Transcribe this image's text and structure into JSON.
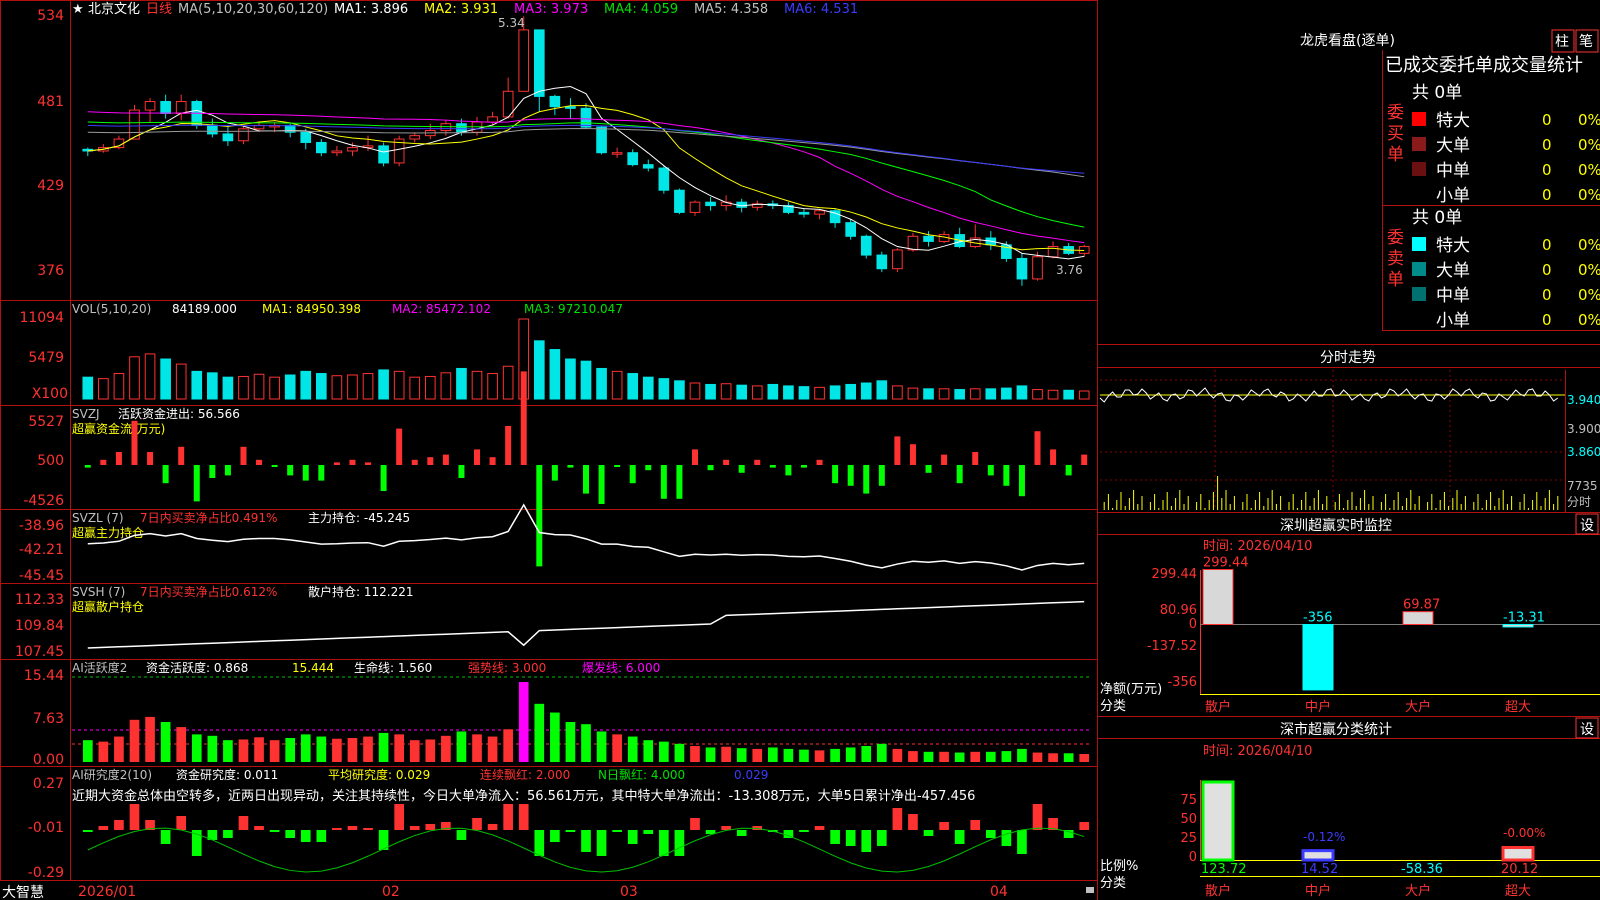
{
  "colors": {
    "up": "#ff3232",
    "down": "#00e5e5",
    "green": "#00ff00",
    "axis": "#ff3232",
    "white": "#ffffff",
    "yellow": "#ffff00",
    "magenta": "#ff00ff",
    "darkblue": "#3c3cff",
    "gray": "#9a9a9a",
    "lime": "#00e000"
  },
  "header": {
    "star": "★",
    "stock_name": "北京文化",
    "period": "日线",
    "ma_text": "MA(5,10,20,30,60,120)",
    "ma1": "MA1: 3.896",
    "ma2": "MA2: 3.931",
    "ma3": "MA3: 3.973",
    "ma4": "MA4: 4.059",
    "ma5": "MA5: 4.358",
    "ma6": "MA6: 4.531",
    "high_label": "5.34",
    "low_label": "3.76"
  },
  "price_axis": [
    "534",
    "481",
    "429",
    "376"
  ],
  "vol": {
    "label": "VOL(5,10,20)",
    "value": "84189.000",
    "ma1": "MA1: 84950.398",
    "ma2": "MA2: 85472.102",
    "ma3": "MA3: 97210.047",
    "axis": [
      "11094",
      "5479",
      "X100"
    ]
  },
  "svzj": {
    "label": "SVZJ",
    "text": "活跃资金进出: 56.566",
    "subtitle": "超赢资金流(万元)",
    "axis": [
      "5527",
      "500",
      "-4526"
    ]
  },
  "svzl": {
    "label": "SVZL (7)",
    "pct": "7日内买卖净占比0.491%",
    "text": "主力持仓: -45.245",
    "subtitle": "超赢主力持仓",
    "axis": [
      "-38.96",
      "-42.21",
      "-45.45"
    ]
  },
  "svsh": {
    "label": "SVSH (7)",
    "pct": "7日内买卖净占比0.612%",
    "text": "散户持仓: 112.221",
    "subtitle": "超赢散户持仓",
    "axis": [
      "112.33",
      "109.84",
      "107.45"
    ]
  },
  "ai1": {
    "label": "AI活跃度2",
    "t1": "资金活跃度: 0.868",
    "t2": "15.444",
    "t3": "生命线: 1.560",
    "t4": "强势线: 3.000",
    "t5": "爆发线: 6.000",
    "axis": [
      "15.44",
      "7.63",
      "0.00"
    ]
  },
  "ai2": {
    "label": "AI研究度2(10)",
    "t1": "资金研究度: 0.011",
    "t2": "平均研究度: 0.029",
    "t3": "连续飘红: 2.000",
    "t4": "N日飘红: 4.000",
    "t5": "0.029",
    "comment": "近期大资金总体由空转多，近两日出现异动，关注其持续性，今日大单净流入：56.561万元，其中特大单净流出：-13.308万元，大单5日累计净出-457.456",
    "axis": [
      "0.27",
      "-0.01",
      "-0.29"
    ]
  },
  "dates": {
    "left": "大智慧",
    "d1": "2026/01",
    "d2": "02",
    "d3": "03",
    "d4": "04"
  },
  "lhb": {
    "title": "龙虎看盘(逐单)",
    "tab1": "柱",
    "tab2": "笔",
    "header": "已成交委托单成交量统计",
    "buy_label": "委买单",
    "sell_label": "委卖单",
    "buy_total": "共 0单",
    "sell_total": "共 0单",
    "rows": [
      {
        "name": "特大",
        "count": "0",
        "pct": "0%"
      },
      {
        "name": "大单",
        "count": "0",
        "pct": "0%"
      },
      {
        "name": "中单",
        "count": "0",
        "pct": "0%"
      },
      {
        "name": "小单",
        "count": "0",
        "pct": "0%"
      }
    ],
    "buy_colors": [
      "#ff0000",
      "#8b1a1a",
      "#6b1010",
      "#000000"
    ],
    "sell_colors": [
      "#00ffff",
      "#008b8b",
      "#007070",
      "#000000"
    ]
  },
  "fenshi": {
    "title": "分时走势",
    "axis": [
      "3.940",
      "3.900",
      "3.860",
      "7735",
      "分时"
    ]
  },
  "monitor": {
    "title": "深圳超赢实时监控",
    "settings": "设",
    "time": "时间: 2026/04/10",
    "y_axis": [
      "299.44",
      "80.96",
      "0",
      "-137.52",
      "-356"
    ],
    "y_label1": "净额(万元)",
    "y_label2": "分类",
    "bars": [
      {
        "name": "散户",
        "value": 299.44,
        "label": "299.44"
      },
      {
        "name": "中户",
        "value": -356,
        "label": "-356"
      },
      {
        "name": "大户",
        "value": 69.87,
        "label": "69.87"
      },
      {
        "name": "超大",
        "value": -13.31,
        "label": "-13.31"
      }
    ]
  },
  "stats": {
    "title": "深市超赢分类统计",
    "settings": "设",
    "time": "时间: 2026/04/10",
    "y_axis": [
      "75",
      "50",
      "25",
      "0"
    ],
    "y_label1": "比例%",
    "y_label2": "分类",
    "pct_labels": [
      "-0.12%",
      "-0.00%"
    ],
    "cats": [
      {
        "name": "散户",
        "value": "123.72",
        "pct": 100
      },
      {
        "name": "中户",
        "value": "14.52",
        "pct": 12
      },
      {
        "name": "大户",
        "value": "-58.36",
        "pct": 0
      },
      {
        "name": "超大",
        "value": "20.12",
        "pct": 16
      }
    ]
  },
  "chart_data": {
    "type": "bar",
    "title": "北京文化 日线",
    "candles": [
      [
        4.56,
        4.55,
        4.57,
        4.52
      ],
      [
        4.55,
        4.57,
        4.59,
        4.54
      ],
      [
        4.57,
        4.62,
        4.64,
        4.56
      ],
      [
        4.62,
        4.79,
        4.82,
        4.62
      ],
      [
        4.79,
        4.84,
        4.86,
        4.72
      ],
      [
        4.84,
        4.77,
        4.88,
        4.74
      ],
      [
        4.77,
        4.84,
        4.88,
        4.73
      ],
      [
        4.84,
        4.7,
        4.85,
        4.68
      ],
      [
        4.7,
        4.65,
        4.74,
        4.63
      ],
      [
        4.65,
        4.61,
        4.7,
        4.58
      ],
      [
        4.61,
        4.68,
        4.7,
        4.59
      ],
      [
        4.68,
        4.7,
        4.72,
        4.66
      ],
      [
        4.7,
        4.7,
        4.72,
        4.66
      ],
      [
        4.7,
        4.66,
        4.71,
        4.63
      ],
      [
        4.66,
        4.6,
        4.68,
        4.56
      ],
      [
        4.6,
        4.54,
        4.62,
        4.52
      ],
      [
        4.54,
        4.55,
        4.58,
        4.52
      ],
      [
        4.55,
        4.57,
        4.6,
        4.52
      ],
      [
        4.57,
        4.58,
        4.64,
        4.55
      ],
      [
        4.58,
        4.48,
        4.6,
        4.46
      ],
      [
        4.48,
        4.62,
        4.64,
        4.46
      ],
      [
        4.62,
        4.64,
        4.66,
        4.6
      ],
      [
        4.64,
        4.67,
        4.71,
        4.62
      ],
      [
        4.67,
        4.71,
        4.73,
        4.64
      ],
      [
        4.71,
        4.66,
        4.74,
        4.64
      ],
      [
        4.66,
        4.72,
        4.75,
        4.64
      ],
      [
        4.72,
        4.75,
        4.78,
        4.7
      ],
      [
        4.75,
        4.9,
        4.98,
        4.74
      ],
      [
        4.9,
        5.26,
        5.34,
        4.9
      ],
      [
        5.26,
        4.87,
        5.26,
        4.78
      ],
      [
        4.87,
        4.81,
        4.88,
        4.76
      ],
      [
        4.81,
        4.8,
        4.86,
        4.74
      ],
      [
        4.8,
        4.69,
        4.83,
        4.68
      ],
      [
        4.69,
        4.54,
        4.7,
        4.53
      ],
      [
        4.54,
        4.54,
        4.57,
        4.51
      ],
      [
        4.54,
        4.47,
        4.56,
        4.46
      ],
      [
        4.47,
        4.45,
        4.5,
        4.43
      ],
      [
        4.45,
        4.32,
        4.46,
        4.3
      ],
      [
        4.32,
        4.19,
        4.33,
        4.18
      ],
      [
        4.19,
        4.25,
        4.26,
        4.17
      ],
      [
        4.25,
        4.23,
        4.28,
        4.2
      ],
      [
        4.23,
        4.25,
        4.29,
        4.2
      ],
      [
        4.25,
        4.22,
        4.27,
        4.19
      ],
      [
        4.22,
        4.24,
        4.26,
        4.2
      ],
      [
        4.24,
        4.23,
        4.26,
        4.21
      ],
      [
        4.23,
        4.19,
        4.25,
        4.18
      ],
      [
        4.19,
        4.18,
        4.21,
        4.16
      ],
      [
        4.18,
        4.2,
        4.21,
        4.15
      ],
      [
        4.2,
        4.13,
        4.21,
        4.1
      ],
      [
        4.13,
        4.05,
        4.15,
        4.03
      ],
      [
        4.05,
        3.94,
        4.06,
        3.92
      ],
      [
        3.94,
        3.86,
        3.96,
        3.84
      ],
      [
        3.86,
        3.97,
        3.98,
        3.84
      ],
      [
        3.97,
        4.05,
        4.07,
        3.96
      ],
      [
        4.05,
        4.02,
        4.08,
        3.99
      ],
      [
        4.02,
        4.06,
        4.08,
        4.01
      ],
      [
        4.06,
        3.99,
        4.1,
        3.98
      ],
      [
        3.99,
        4.04,
        4.12,
        3.98
      ],
      [
        4.04,
        4.0,
        4.08,
        3.97
      ],
      [
        4.0,
        3.92,
        4.02,
        3.9
      ],
      [
        3.92,
        3.8,
        3.95,
        3.76
      ],
      [
        3.8,
        3.93,
        3.96,
        3.79
      ],
      [
        3.93,
        3.99,
        4.02,
        3.92
      ],
      [
        3.99,
        3.95,
        4.01,
        3.94
      ],
      [
        3.95,
        3.99,
        4.0,
        3.93
      ]
    ],
    "volume": [
      30,
      28,
      35,
      58,
      62,
      55,
      48,
      38,
      36,
      30,
      31,
      34,
      30,
      33,
      38,
      35,
      32,
      33,
      35,
      40,
      38,
      30,
      31,
      36,
      42,
      38,
      35,
      45,
      110,
      80,
      68,
      55,
      52,
      42,
      38,
      35,
      30,
      28,
      25,
      22,
      20,
      21,
      19,
      18,
      20,
      18,
      17,
      16,
      18,
      20,
      22,
      25,
      18,
      15,
      14,
      14,
      13,
      14,
      14,
      15,
      18,
      13,
      12,
      12,
      11
    ],
    "ylim": [
      3.7,
      5.4
    ]
  }
}
